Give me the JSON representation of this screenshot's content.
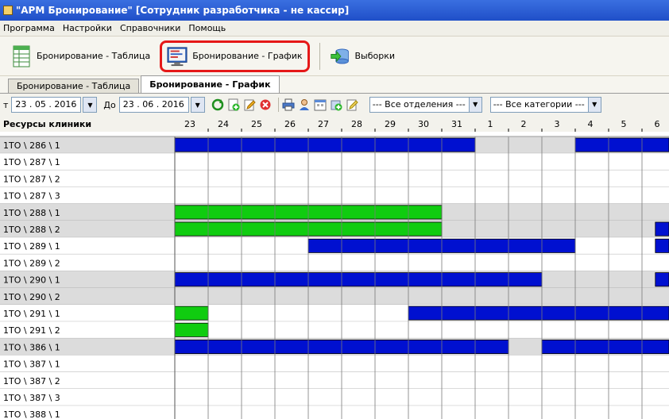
{
  "window": {
    "title": "\"АРМ Бронирование\" [Сотрудник разработчика - не кассир]"
  },
  "menu": [
    "Программа",
    "Настройки",
    "Справочники",
    "Помощь"
  ],
  "toolbar": {
    "table_label": "Бронирование - Таблица",
    "chart_label": "Бронирование - График",
    "selections_label": "Выборки"
  },
  "tabs": [
    "Бронирование - Таблица",
    "Бронирование - График"
  ],
  "filter": {
    "from_label": "т",
    "from_value": "23 . 05 . 2016",
    "to_label": "До",
    "to_value": "23 . 06 . 2016",
    "department": "--- Все отделения ---",
    "category": "--- Все категории ---"
  },
  "grid": {
    "header": "Ресурсы клиники",
    "days": [
      "23",
      "24",
      "25",
      "26",
      "27",
      "28",
      "29",
      "30",
      "31",
      "1",
      "2",
      "3",
      "4",
      "5",
      "6"
    ],
    "colors": {
      "blue": "#0010d0",
      "green": "#10cc10",
      "alt_row": "#dcdcdc"
    },
    "rows": [
      {
        "name": "1ТО \\ 286 \\ 1",
        "shaded": true,
        "bars": [
          {
            "start": 0,
            "end": 9,
            "color": "blue"
          },
          {
            "start": 12,
            "end": 15,
            "color": "blue"
          }
        ]
      },
      {
        "name": "1ТО \\ 287 \\ 1",
        "shaded": false,
        "bars": []
      },
      {
        "name": "1ТО \\ 287 \\ 2",
        "shaded": false,
        "bars": []
      },
      {
        "name": "1ТО \\ 287 \\ 3",
        "shaded": false,
        "bars": []
      },
      {
        "name": "1ТО \\ 288 \\ 1",
        "shaded": true,
        "bars": [
          {
            "start": 0,
            "end": 8,
            "color": "green"
          }
        ]
      },
      {
        "name": "1ТО \\ 288 \\ 2",
        "shaded": true,
        "bars": [
          {
            "start": 0,
            "end": 8,
            "color": "green"
          },
          {
            "start": 14.4,
            "end": 15,
            "color": "blue"
          }
        ]
      },
      {
        "name": "1ТО \\ 289 \\ 1",
        "shaded": false,
        "bars": [
          {
            "start": 4,
            "end": 12,
            "color": "blue"
          },
          {
            "start": 14.4,
            "end": 15,
            "color": "blue"
          }
        ]
      },
      {
        "name": "1ТО \\ 289 \\ 2",
        "shaded": false,
        "bars": []
      },
      {
        "name": "1ТО \\ 290 \\ 1",
        "shaded": true,
        "bars": [
          {
            "start": 0,
            "end": 11,
            "color": "blue"
          },
          {
            "start": 14.4,
            "end": 15,
            "color": "blue"
          }
        ]
      },
      {
        "name": "1ТО \\ 290 \\ 2",
        "shaded": true,
        "bars": []
      },
      {
        "name": "1ТО \\ 291 \\ 1",
        "shaded": false,
        "bars": [
          {
            "start": 0,
            "end": 1,
            "color": "green"
          },
          {
            "start": 7,
            "end": 15,
            "color": "blue"
          }
        ]
      },
      {
        "name": "1ТО \\ 291 \\ 2",
        "shaded": false,
        "bars": [
          {
            "start": 0,
            "end": 1,
            "color": "green"
          }
        ]
      },
      {
        "name": "1ТО \\ 386 \\ 1",
        "shaded": true,
        "bars": [
          {
            "start": 0,
            "end": 10,
            "color": "blue"
          },
          {
            "start": 11,
            "end": 15,
            "color": "blue"
          }
        ]
      },
      {
        "name": "1ТО \\ 387 \\ 1",
        "shaded": false,
        "bars": []
      },
      {
        "name": "1ТО \\ 387 \\ 2",
        "shaded": false,
        "bars": []
      },
      {
        "name": "1ТО \\ 387 \\ 3",
        "shaded": false,
        "bars": []
      },
      {
        "name": "1ТО \\ 388 \\ 1",
        "shaded": false,
        "bars": []
      }
    ]
  }
}
